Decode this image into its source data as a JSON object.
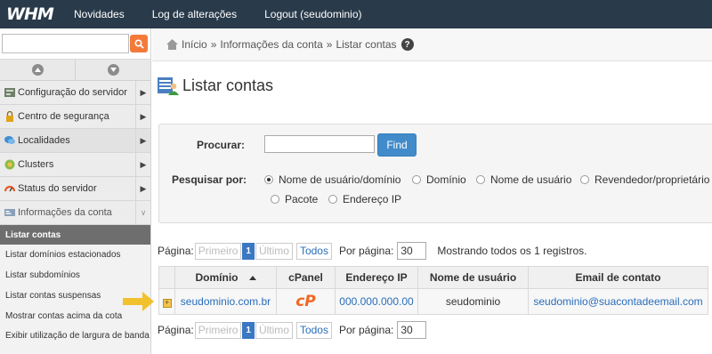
{
  "topbar": {
    "logo": "WHM",
    "nav": [
      "Novidades",
      "Log de alterações",
      "Logout (seudominio)"
    ]
  },
  "sidebar": {
    "search_value": "",
    "categories": [
      {
        "label": "Configuração do servidor",
        "icon": "server-config-icon"
      },
      {
        "label": "Centro de segurança",
        "icon": "lock-icon"
      },
      {
        "label": "Localidades",
        "icon": "speech-bubble-icon"
      },
      {
        "label": "Clusters",
        "icon": "clusters-icon"
      },
      {
        "label": "Status do servidor",
        "icon": "gauge-icon"
      },
      {
        "label": "Informações da conta",
        "icon": "account-info-icon"
      }
    ],
    "subitems": [
      "Listar contas",
      "Listar domínios estacionados",
      "Listar subdomínios",
      "Listar contas suspensas",
      "Mostrar contas acima da cota",
      "Exibir utilização de largura de banda"
    ]
  },
  "breadcrumb": {
    "items": [
      "Início",
      "Informações da conta",
      "Listar contas"
    ],
    "separator": "»",
    "help": "?"
  },
  "page": {
    "title": "Listar contas"
  },
  "search": {
    "label": "Procurar:",
    "value": "",
    "button": "Find",
    "by_label": "Pesquisar por:",
    "options": [
      "Nome de usuário/domínio",
      "Domínio",
      "Nome de usuário",
      "Revendedor/proprietário",
      "Pacote",
      "Endereço IP"
    ],
    "selected": "Nome de usuário/domínio"
  },
  "pager": {
    "label": "Página:",
    "first": "Primeiro",
    "current": "1",
    "last": "Último",
    "all": "Todos",
    "per_page_label": "Por página:",
    "per_page": "30",
    "showing": "Mostrando todos os 1 registros."
  },
  "table": {
    "headers": [
      "Domínio",
      "cPanel",
      "Endereço IP",
      "Nome de usuário",
      "Email de contato"
    ],
    "rows": [
      {
        "expand": "+",
        "domain": "seudominio.com.br",
        "cpanel": "cP",
        "ip": "000.000.000.00",
        "user": "seudominio",
        "email": "seudominio@suacontadeemail.com"
      }
    ]
  },
  "colors": {
    "topbar_bg": "#293a4a",
    "find_button": "#428bca",
    "link": "#2a6ebb",
    "cpanel_orange": "#f26722",
    "pointer_arrow": "#f2c12e"
  }
}
